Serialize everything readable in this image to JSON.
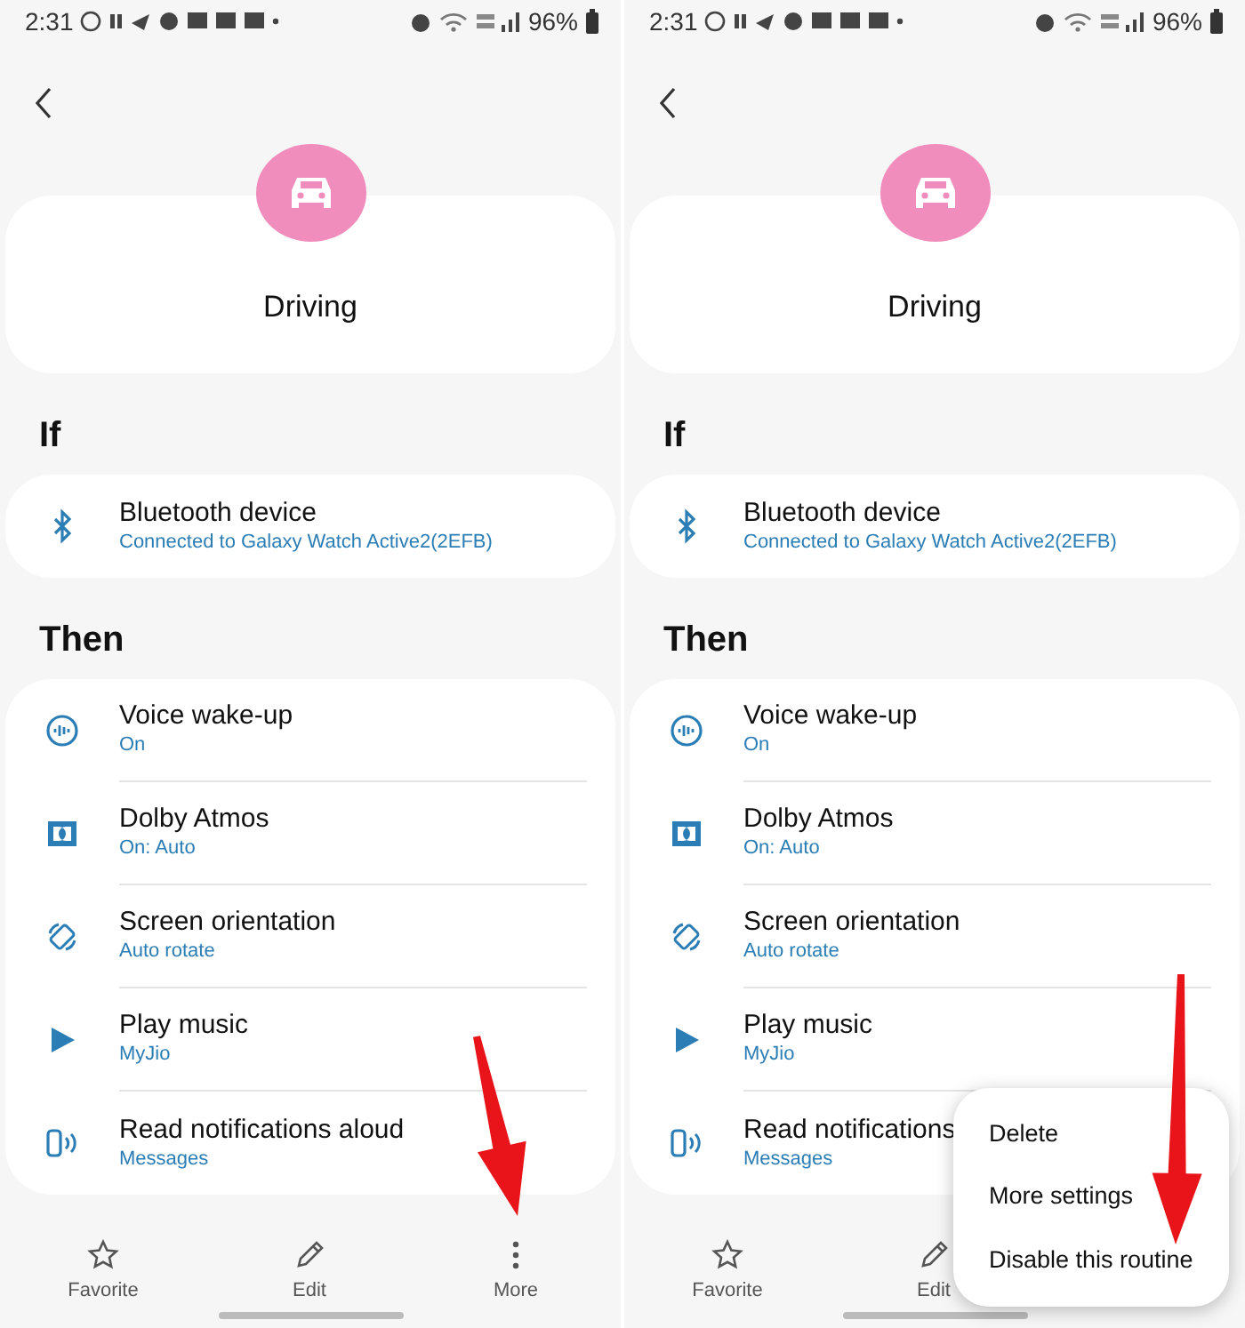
{
  "screens": [
    {
      "status_bar": {
        "time": "2:31",
        "battery": "96%"
      },
      "title": "Driving",
      "if_label": "If",
      "trigger": {
        "kind": "bluetooth",
        "title": "Bluetooth device",
        "subtitle": "Connected to Galaxy Watch Active2(2EFB)"
      },
      "then_label": "Then",
      "actions": [
        {
          "kind": "voice",
          "title": "Voice wake-up",
          "subtitle": "On"
        },
        {
          "kind": "dolby",
          "title": "Dolby Atmos",
          "subtitle": "On: Auto"
        },
        {
          "kind": "rotate",
          "title": "Screen orientation",
          "subtitle": "Auto rotate"
        },
        {
          "kind": "play",
          "title": "Play music",
          "subtitle": "MyJio"
        },
        {
          "kind": "notify",
          "title": "Read notifications aloud",
          "subtitle": "Messages"
        }
      ],
      "bottom_bar": [
        {
          "kind": "star",
          "label": "Favorite"
        },
        {
          "kind": "pencil",
          "label": "Edit"
        },
        {
          "kind": "more",
          "label": "More"
        }
      ],
      "annotation_arrow": true
    },
    {
      "status_bar": {
        "time": "2:31",
        "battery": "96%"
      },
      "title": "Driving",
      "if_label": "If",
      "trigger": {
        "kind": "bluetooth",
        "title": "Bluetooth device",
        "subtitle": "Connected to Galaxy Watch Active2(2EFB)"
      },
      "then_label": "Then",
      "actions": [
        {
          "kind": "voice",
          "title": "Voice wake-up",
          "subtitle": "On"
        },
        {
          "kind": "dolby",
          "title": "Dolby Atmos",
          "subtitle": "On: Auto"
        },
        {
          "kind": "rotate",
          "title": "Screen orientation",
          "subtitle": "Auto rotate"
        },
        {
          "kind": "play",
          "title": "Play music",
          "subtitle": "MyJio"
        },
        {
          "kind": "notify",
          "title": "Read notifications",
          "subtitle": "Messages"
        }
      ],
      "bottom_bar": [
        {
          "kind": "star",
          "label": "Favorite"
        },
        {
          "kind": "pencil",
          "label": "Edit"
        }
      ],
      "menu": [
        "Delete",
        "More settings",
        "Disable this routine"
      ],
      "annotation_arrow": true
    }
  ]
}
